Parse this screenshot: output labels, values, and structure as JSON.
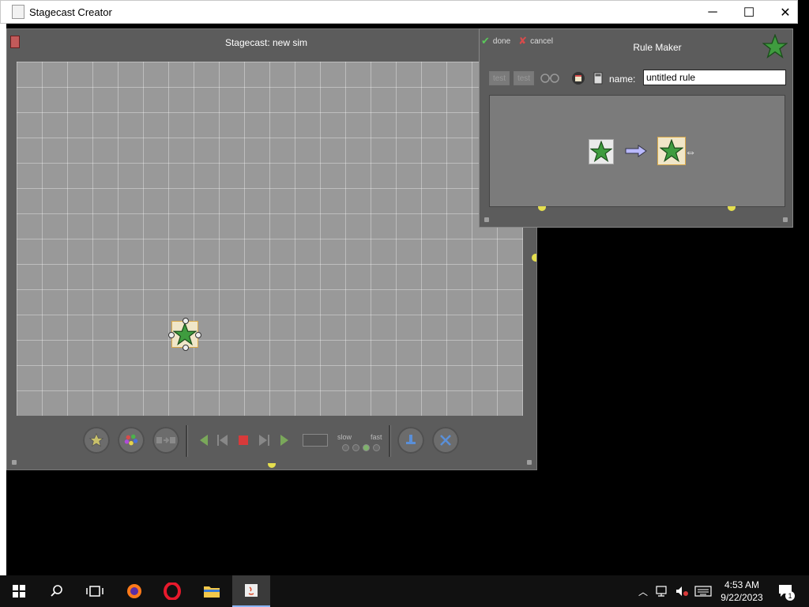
{
  "app": {
    "title": "Stagecast Creator"
  },
  "window_controls": {
    "minimize": "─",
    "maximize": "☐",
    "close": "✕"
  },
  "stage": {
    "title": "Stagecast: new sim",
    "speed": {
      "slow_label": "slow",
      "fast_label": "fast",
      "levels": 4,
      "selected": 3
    }
  },
  "rule_maker": {
    "title": "Rule Maker",
    "done_label": "done",
    "cancel_label": "cancel",
    "test_label": "test",
    "name_label": "name:",
    "name_value": "untitled rule"
  },
  "taskbar": {
    "time": "4:53 AM",
    "date": "9/22/2023",
    "notification_count": "1",
    "apps": [
      "start-icon",
      "search-icon",
      "task-view-icon",
      "firefox-icon",
      "opera-icon",
      "file-explorer-icon",
      "java-icon"
    ]
  },
  "colors": {
    "star": "#3f9c3f",
    "accent": "#8ab4f8",
    "stage_bg": "#5c5c5c"
  }
}
